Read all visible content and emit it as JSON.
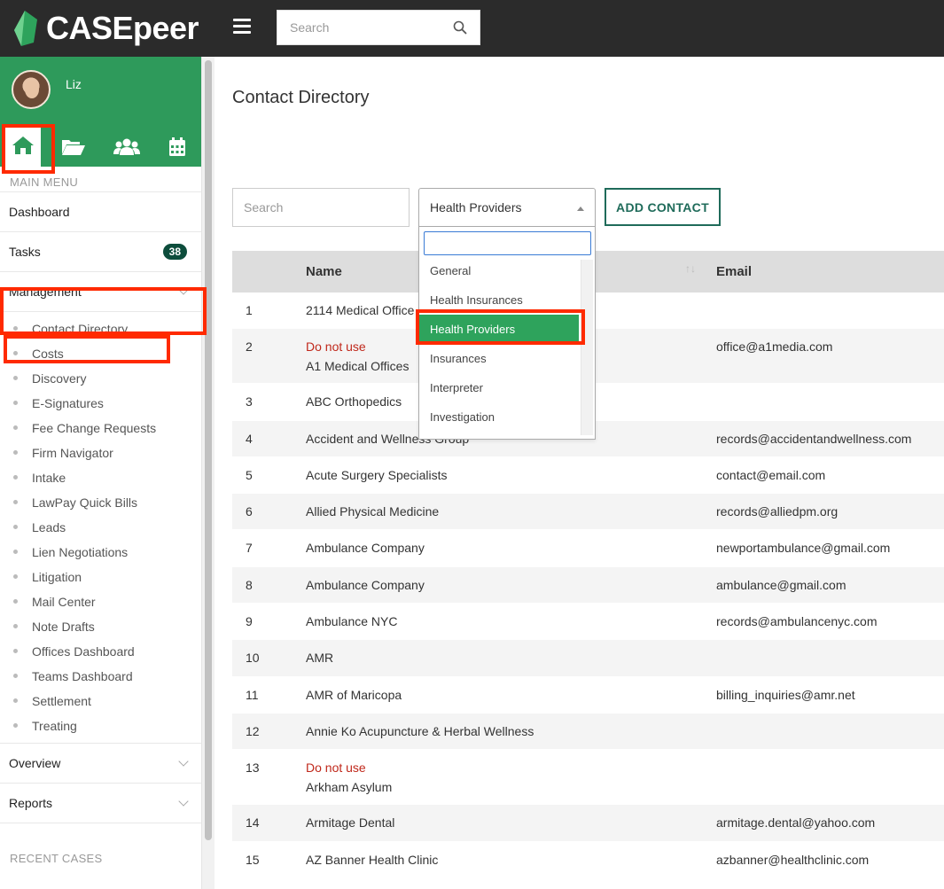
{
  "app": {
    "name": "CASEpeer"
  },
  "topbar": {
    "search_placeholder": "Search"
  },
  "sidebar": {
    "username": "Liz",
    "main_menu_label": "MAIN MENU",
    "items": [
      {
        "label": "Dashboard"
      },
      {
        "label": "Tasks",
        "badge": "38"
      },
      {
        "label": "Management"
      }
    ],
    "management_sub": [
      "Contact Directory",
      "Costs",
      "Discovery",
      "E-Signatures",
      "Fee Change Requests",
      "Firm Navigator",
      "Intake",
      "LawPay Quick Bills",
      "Leads",
      "Lien Negotiations",
      "Litigation",
      "Mail Center",
      "Note Drafts",
      "Offices Dashboard",
      "Teams Dashboard",
      "Settlement",
      "Treating"
    ],
    "bottom_items": [
      {
        "label": "Overview"
      },
      {
        "label": "Reports"
      }
    ],
    "recent_cases_label": "RECENT CASES"
  },
  "main": {
    "title": "Contact Directory",
    "filter_search_placeholder": "Search",
    "category_select": {
      "value": "Health Providers"
    },
    "add_button": "ADD CONTACT",
    "columns": {
      "name": "Name",
      "email": "Email"
    }
  },
  "dropdown": {
    "search_value": "",
    "options": [
      "General",
      "Health Insurances",
      "Health Providers",
      "Insurances",
      "Interpreter",
      "Investigation"
    ],
    "selected": "Health Providers"
  },
  "contacts": [
    {
      "num": "1",
      "name": "2114 Medical Office",
      "email": ""
    },
    {
      "num": "2",
      "flag": "Do not use",
      "name": "A1 Medical Offices",
      "email": "office@a1media.com"
    },
    {
      "num": "3",
      "name": "ABC Orthopedics",
      "email": ""
    },
    {
      "num": "4",
      "name": "Accident and Wellness Group",
      "email": "records@accidentandwellness.com"
    },
    {
      "num": "5",
      "name": "Acute Surgery Specialists",
      "email": "contact@email.com"
    },
    {
      "num": "6",
      "name": "Allied Physical Medicine",
      "email": "records@alliedpm.org"
    },
    {
      "num": "7",
      "name": "Ambulance Company",
      "email": "newportambulance@gmail.com"
    },
    {
      "num": "8",
      "name": "Ambulance Company",
      "email": "ambulance@gmail.com"
    },
    {
      "num": "9",
      "name": "Ambulance NYC",
      "email": "records@ambulancenyc.com"
    },
    {
      "num": "10",
      "name": "AMR",
      "email": ""
    },
    {
      "num": "11",
      "name": "AMR of Maricopa",
      "email": "billing_inquiries@amr.net"
    },
    {
      "num": "12",
      "name": "Annie Ko Acupuncture & Herbal Wellness",
      "email": ""
    },
    {
      "num": "13",
      "flag": "Do not use",
      "name": "Arkham Asylum",
      "email": ""
    },
    {
      "num": "14",
      "name": "Armitage Dental",
      "email": "armitage.dental@yahoo.com"
    },
    {
      "num": "15",
      "name": "AZ Banner Health Clinic",
      "email": "azbanner@healthclinic.com"
    }
  ],
  "colors": {
    "brand_green": "#2e9a5b",
    "highlight": "#ff2a00",
    "do_not_use": "#c0281b",
    "topbar": "#2b2b2b"
  },
  "icons": [
    "logo-icon",
    "menu-icon",
    "search-icon",
    "home-icon",
    "folder-open-icon",
    "users-icon",
    "calendar-icon",
    "chevron-down-icon",
    "sort-icon"
  ]
}
